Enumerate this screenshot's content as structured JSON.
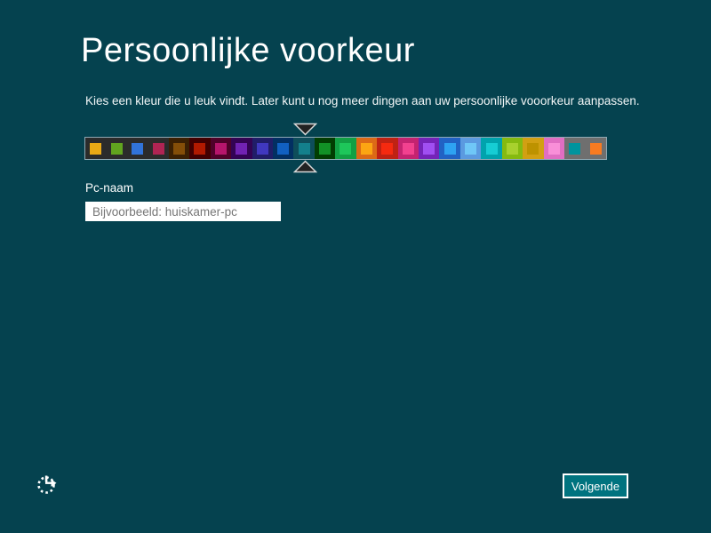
{
  "page": {
    "title": "Persoonlijke voorkeur",
    "subtitle": "Kies een kleur die u leuk vindt. Later kunt u nog meer dingen aan uw persoonlijke vooorkeur aanpassen.",
    "background_color": "#05424f"
  },
  "color_slider": {
    "selected_index": 10,
    "cells": [
      {
        "bg": "#2b2b2b",
        "accent": "#e9a915"
      },
      {
        "bg": "#2b2b2b",
        "accent": "#61a41f"
      },
      {
        "bg": "#2b2b2b",
        "accent": "#3173d9"
      },
      {
        "bg": "#2b2b2b",
        "accent": "#b02453"
      },
      {
        "bg": "#3b2003",
        "accent": "#844e08"
      },
      {
        "bg": "#420001",
        "accent": "#b21a00"
      },
      {
        "bg": "#4f0129",
        "accent": "#b6156c"
      },
      {
        "bg": "#330353",
        "accent": "#7122b3"
      },
      {
        "bg": "#201d68",
        "accent": "#4038bf"
      },
      {
        "bg": "#022f62",
        "accent": "#1160c1"
      },
      {
        "bg": "#0e4d5a",
        "accent": "#13808c"
      },
      {
        "bg": "#023d02",
        "accent": "#129126"
      },
      {
        "bg": "#12a044",
        "accent": "#1ec75a"
      },
      {
        "bg": "#dc6a17",
        "accent": "#fca513"
      },
      {
        "bg": "#bf2213",
        "accent": "#f52a10"
      },
      {
        "bg": "#c42370",
        "accent": "#f2418f"
      },
      {
        "bg": "#7423b8",
        "accent": "#a04ff2"
      },
      {
        "bg": "#2162c4",
        "accent": "#2ea2f2"
      },
      {
        "bg": "#5b9ae0",
        "accent": "#6fc7f7"
      },
      {
        "bg": "#00a3ad",
        "accent": "#16cdd4"
      },
      {
        "bg": "#85ba10",
        "accent": "#a8d12e"
      },
      {
        "bg": "#d2a013",
        "accent": "#bd9200"
      },
      {
        "bg": "#e06ec2",
        "accent": "#f98fd8"
      },
      {
        "bg": "#6f6f6f",
        "accent": "#00949e"
      },
      {
        "bg": "#6f6f6f",
        "accent": "#f77b21"
      }
    ],
    "marker_fill": "#222222",
    "marker_stroke": "#d9d9d9"
  },
  "pc_name": {
    "label": "Pc-naam",
    "placeholder": "Bijvoorbeeld: huiskamer-pc",
    "value": ""
  },
  "buttons": {
    "next_label": "Volgende"
  }
}
